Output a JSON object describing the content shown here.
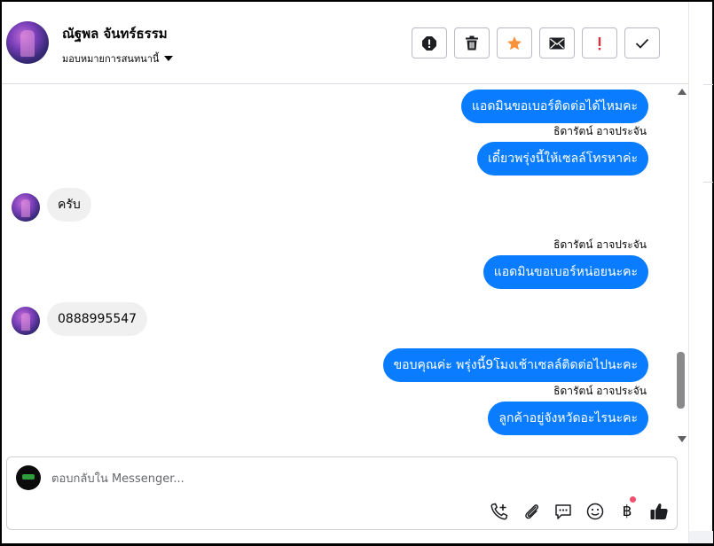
{
  "header": {
    "contact_name": "ณัฐพล จันทร์ธรรม",
    "assign_label": "มอบหมายการสนทนานี้",
    "actions": [
      {
        "name": "report",
        "icon": "alert-circle-icon"
      },
      {
        "name": "delete",
        "icon": "trash-icon"
      },
      {
        "name": "star",
        "icon": "star-icon",
        "color": "#f7923a"
      },
      {
        "name": "mail",
        "icon": "envelope-icon"
      },
      {
        "name": "spam",
        "icon": "exclamation-icon",
        "color": "#e02d3c"
      },
      {
        "name": "done",
        "icon": "check-icon"
      }
    ]
  },
  "messages": [
    {
      "direction": "outgoing",
      "text": "แอดมินขอเบอร์ติดต่อได้ไหมคะ"
    },
    {
      "direction": "outgoing",
      "sender": "ธิดารัตน์ อาจประจัน",
      "text": "เดี๋ยวพรุ่งนี้ให้เซลล์โทรหาค่ะ"
    },
    {
      "direction": "incoming",
      "text": "ครับ"
    },
    {
      "direction": "outgoing",
      "sender": "ธิดารัตน์ อาจประจัน",
      "text": "แอดมินขอเบอร์หน่อยนะคะ"
    },
    {
      "direction": "incoming",
      "text": "0888995547"
    },
    {
      "direction": "outgoing",
      "text": "ขอบคุณค่ะ พรุ่งนี้9โมงเช้าเซลล์ติดต่อไปนะคะ"
    },
    {
      "direction": "outgoing",
      "sender": "ธิดารัตน์ อาจประจัน",
      "text": "ลูกค้าอยู่จังหวัดอะไรนะคะ"
    }
  ],
  "scroll": {
    "position": 0.92,
    "visible_fraction": 0.17
  },
  "composer": {
    "placeholder": "ตอบกลับใน Messenger...",
    "value": "",
    "tools": [
      {
        "name": "call",
        "icon": "phone-plus-icon"
      },
      {
        "name": "attach",
        "icon": "paperclip-icon"
      },
      {
        "name": "saved-replies",
        "icon": "chat-bubble-icon"
      },
      {
        "name": "emoji",
        "icon": "smiley-icon"
      },
      {
        "name": "payment",
        "icon": "baht-icon",
        "glyph": "฿",
        "badge_color": "#f0506e"
      },
      {
        "name": "like",
        "icon": "thumbs-up-icon"
      }
    ]
  },
  "colors": {
    "outgoing_bubble": "#0a7cff",
    "incoming_bubble": "#f0f0f0",
    "accent_star": "#f7923a",
    "accent_alert": "#e02d3c"
  }
}
